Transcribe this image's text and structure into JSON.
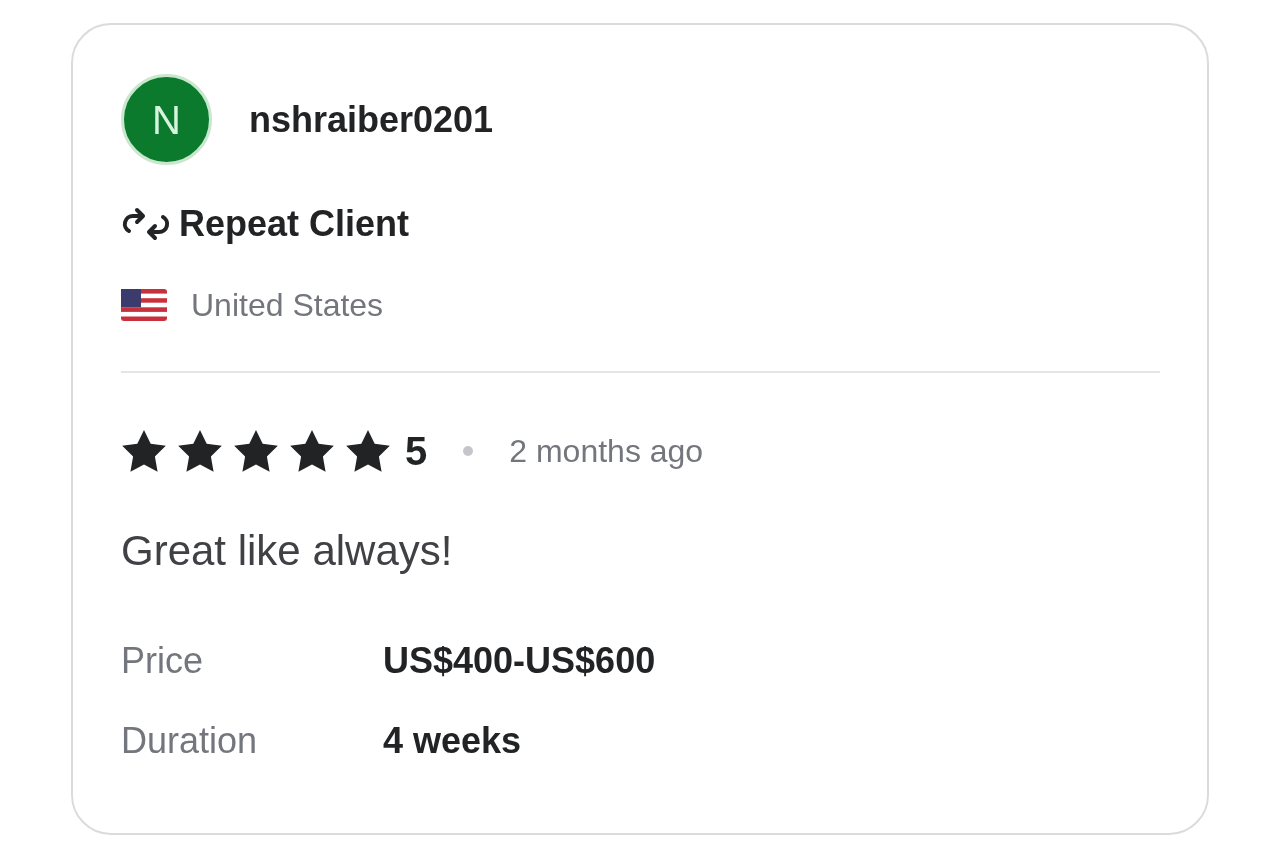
{
  "reviewer": {
    "initial": "N",
    "username": "nshraiber0201",
    "badge": "Repeat Client",
    "country": "United States"
  },
  "review": {
    "stars": 5,
    "rating": "5",
    "time": "2 months ago",
    "text": "Great like always!"
  },
  "details": [
    {
      "label": "Price",
      "value": "US$400-US$600"
    },
    {
      "label": "Duration",
      "value": "4 weeks"
    }
  ]
}
